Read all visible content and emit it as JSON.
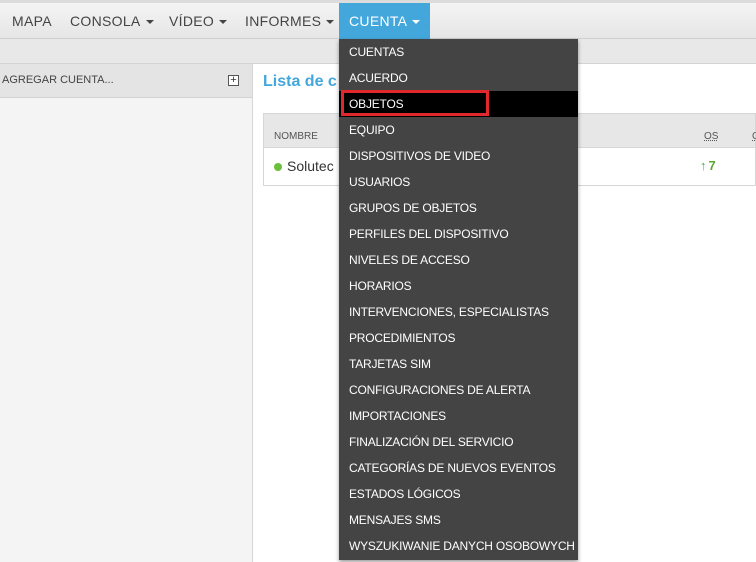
{
  "nav": {
    "items": [
      {
        "label": "MAPA",
        "dropdown": false
      },
      {
        "label": "CONSOLA",
        "dropdown": true
      },
      {
        "label": "VÍDEO",
        "dropdown": true
      },
      {
        "label": "INFORMES",
        "dropdown": true
      },
      {
        "label": "CUENTA",
        "dropdown": true,
        "active": true
      }
    ]
  },
  "sidebar": {
    "header_label": "AGREGAR CUENTA...",
    "add_icon": "plus-square-icon"
  },
  "main": {
    "title": "Lista de c",
    "table": {
      "columns": [
        "NOMBRE",
        "OS",
        "C"
      ],
      "rows": [
        {
          "name": "Solutec",
          "status": "online",
          "os_value": "7",
          "trend": "up"
        }
      ]
    }
  },
  "dropdown": {
    "items": [
      "CUENTAS",
      "ACUERDO",
      "OBJETOS",
      "EQUIPO",
      "DISPOSITIVOS DE VIDEO",
      "USUARIOS",
      "GRUPOS DE OBJETOS",
      "PERFILES DEL DISPOSITIVO",
      "NIVELES DE ACCESO",
      "HORARIOS",
      "INTERVENCIONES, ESPECIALISTAS",
      "PROCEDIMIENTOS",
      "TARJETAS SIM",
      "CONFIGURACIONES DE ALERTA",
      "IMPORTACIONES",
      "FINALIZACIÓN DEL SERVICIO",
      "CATEGORÍAS DE NUEVOS EVENTOS",
      "ESTADOS LÓGICOS",
      "MENSAJES SMS",
      "WYSZUKIWANIE DANYCH OSOBOWYCH"
    ],
    "selected_index": 2
  },
  "colors": {
    "accent": "#43a7dc",
    "dropdown_bg": "#444444",
    "highlight": "#e0282d",
    "status_green": "#6cbf3a"
  }
}
